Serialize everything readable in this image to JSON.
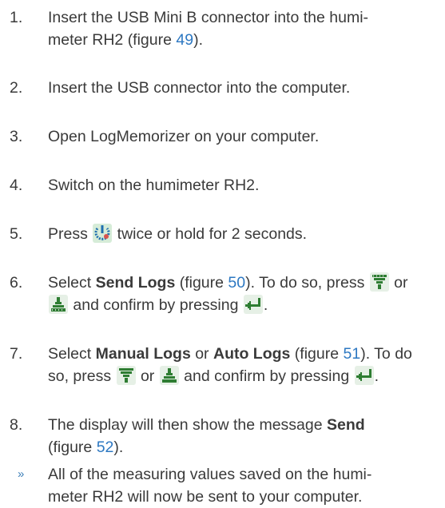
{
  "steps": [
    {
      "num": "1.",
      "a": "Insert the USB Mini B connector into the humi-",
      "b": "meter RH2 (figure ",
      "ref": "49",
      "c": ")."
    },
    {
      "num": "2.",
      "text": "Insert the USB connector into the computer."
    },
    {
      "num": "3.",
      "text": "Open LogMemorizer on your computer."
    },
    {
      "num": "4.",
      "text": "Switch on the humimeter RH2."
    },
    {
      "num": "5.",
      "a": "Press ",
      "b": " twice or hold for 2 seconds."
    },
    {
      "num": "6.",
      "a": "Select ",
      "bold": "Send Logs",
      "b": " (figure ",
      "ref": "50",
      "c": "). To do so, press ",
      "d": " or",
      "e": " and confirm by pressing ",
      "f": "."
    },
    {
      "num": "7.",
      "a": "Select ",
      "bold1": "Manual Logs",
      "b": " or ",
      "bold2": "Auto Logs",
      "c": " (figure ",
      "ref": "51",
      "d": "). To do",
      "e": "so, press ",
      "f": " or ",
      "g": " and confirm by pressing ",
      "h": "."
    },
    {
      "num": "8.",
      "a": "The display will then show the message ",
      "bold": "Send",
      "b": "(figure ",
      "ref": "52",
      "c": ")."
    }
  ],
  "result": {
    "marker": "»",
    "line1": "All of the measuring values saved on the humi-",
    "line2": "meter RH2 will now be sent to your computer."
  },
  "icons": {
    "power": "power-menu-icon",
    "down": "arrow-down-icon",
    "up": "arrow-up-icon",
    "enter": "enter-icon",
    "accent": "#2e7d32",
    "link": "#2d78c2"
  }
}
